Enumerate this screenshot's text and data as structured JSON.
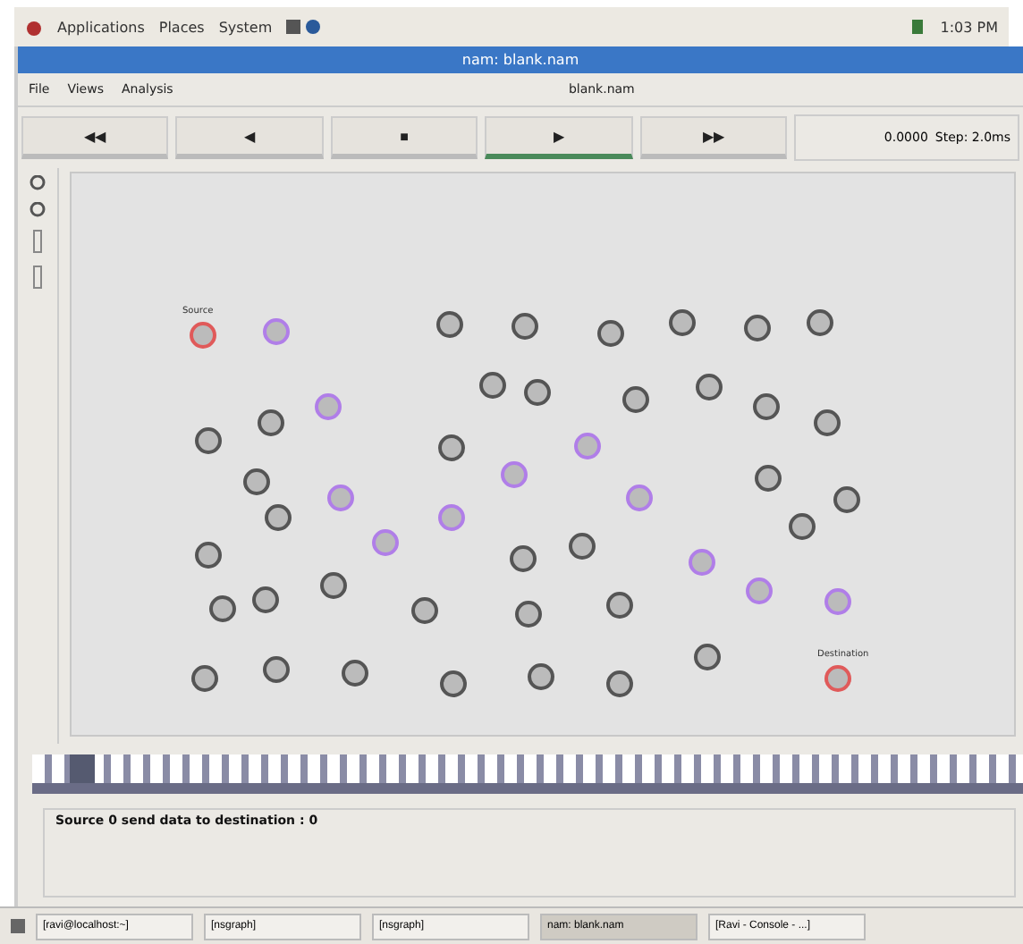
{
  "top_panel": {
    "menus": [
      "Applications",
      "Places",
      "System"
    ],
    "clock": "1:03 PM"
  },
  "window": {
    "title": "nam: blank.nam"
  },
  "menu_bar": {
    "items": [
      "File",
      "Views",
      "Analysis"
    ],
    "file_name": "blank.nam"
  },
  "transport": [
    {
      "label": "◀◀",
      "selected": false
    },
    {
      "label": "◀",
      "selected": false
    },
    {
      "label": "■",
      "selected": false
    },
    {
      "label": "▶",
      "selected": true
    },
    {
      "label": "▶▶",
      "selected": false
    }
  ],
  "time": "0.0000",
  "step": "Step: 2.0ms",
  "nodes": [
    {
      "label": "Source",
      "color": "#e05a5a"
    },
    {
      "color": "#b07ee8"
    },
    {
      "color": "#555555"
    },
    {
      "color": "#555555"
    },
    {
      "color": "#555555"
    },
    {
      "color": "#555555"
    },
    {
      "color": "#555555"
    },
    {
      "color": "#555555"
    },
    {
      "color": "#b07ee8"
    },
    {
      "color": "#555555"
    },
    {
      "color": "#555555"
    },
    {
      "color": "#555555"
    },
    {
      "color": "#555555"
    },
    {
      "color": "#555555"
    },
    {
      "color": "#555555"
    },
    {
      "color": "#555555"
    },
    {
      "color": "#555555"
    },
    {
      "color": "#555555"
    },
    {
      "color": "#b07ee8"
    },
    {
      "color": "#b07ee8"
    },
    {
      "color": "#555555"
    },
    {
      "color": "#555555"
    },
    {
      "color": "#555555"
    },
    {
      "color": "#555555"
    },
    {
      "color": "#555555"
    },
    {
      "color": "#555555"
    },
    {
      "color": "#555555"
    },
    {
      "color": "#555555"
    },
    {
      "color": "#b07ee8"
    },
    {
      "color": "#b07ee8"
    },
    {
      "color": "#b07ee8"
    },
    {
      "color": "#b07ee8"
    },
    {
      "color": "#b07ee8"
    },
    {
      "color": "#b07ee8"
    },
    {
      "color": "#b07ee8"
    },
    {
      "color": "#555555"
    },
    {
      "color": "#555555"
    },
    {
      "color": "#555555"
    },
    {
      "color": "#555555"
    },
    {
      "color": "#555555"
    },
    {
      "color": "#555555"
    },
    {
      "color": "#555555"
    },
    {
      "color": "#555555"
    },
    {
      "color": "#555555"
    },
    {
      "color": "#555555"
    },
    {
      "color": "#555555"
    },
    {
      "color": "#555555"
    },
    {
      "color": "#555555"
    },
    {
      "label": "Destination",
      "color": "#e05a5a"
    }
  ],
  "timeline": {
    "level": 0.05
  },
  "message": "Source 0 send data to destination : 0",
  "taskbar": [
    {
      "label": "[ravi@localhost:~]",
      "selected": false
    },
    {
      "label": "[nsgraph]",
      "selected": false
    },
    {
      "label": "[nsgraph]",
      "selected": false
    },
    {
      "label": "nam: blank.nam",
      "selected": true
    },
    {
      "label": "[Ravi - Console - ...]",
      "selected": false
    }
  ]
}
